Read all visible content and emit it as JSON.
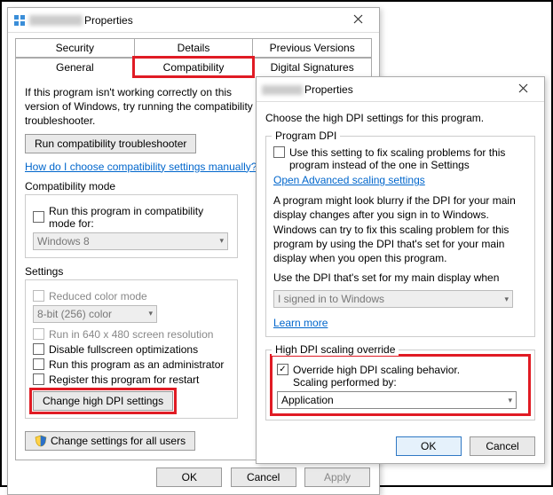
{
  "dialog1": {
    "title_suffix": "Properties",
    "tabs_top": [
      "Security",
      "Details",
      "Previous Versions"
    ],
    "tabs_bottom": [
      "General",
      "Compatibility",
      "Digital Signatures"
    ],
    "intro": "If this program isn't working correctly on this version of Windows, try running the compatibility troubleshooter.",
    "run_troubleshooter": "Run compatibility troubleshooter",
    "manual_link": "How do I choose compatibility settings manually?",
    "compat_mode_title": "Compatibility mode",
    "compat_mode_chk": "Run this program in compatibility mode for:",
    "compat_mode_sel": "Windows 8",
    "settings_title": "Settings",
    "reduced_color": "Reduced color mode",
    "color_sel": "8-bit (256) color",
    "res640": "Run in 640 x 480 screen resolution",
    "disable_fs": "Disable fullscreen optimizations",
    "run_admin": "Run this program as an administrator",
    "register_restart": "Register this program for restart",
    "change_dpi": "Change high DPI settings",
    "change_all": "Change settings for all users",
    "ok": "OK",
    "cancel": "Cancel",
    "apply": "Apply"
  },
  "dialog2": {
    "title_suffix": "Properties",
    "intro": "Choose the high DPI settings for this program.",
    "group1_title": "Program DPI",
    "g1_chk": "Use this setting to fix scaling problems for this program instead of the one in Settings",
    "g1_link": "Open Advanced scaling settings",
    "g1_para": "A program might look blurry if the DPI for your main display changes after you sign in to Windows. Windows can try to fix this scaling problem for this program by using the DPI that's set for your main display when you open this program.",
    "g1_use": "Use the DPI that's set for my main display when",
    "g1_sel": "I signed in to Windows",
    "g1_learn": "Learn more",
    "group2_title": "High DPI scaling override",
    "g2_chk1": "Override high DPI scaling behavior.",
    "g2_chk2": "Scaling performed by:",
    "g2_sel": "Application",
    "ok": "OK",
    "cancel": "Cancel"
  }
}
